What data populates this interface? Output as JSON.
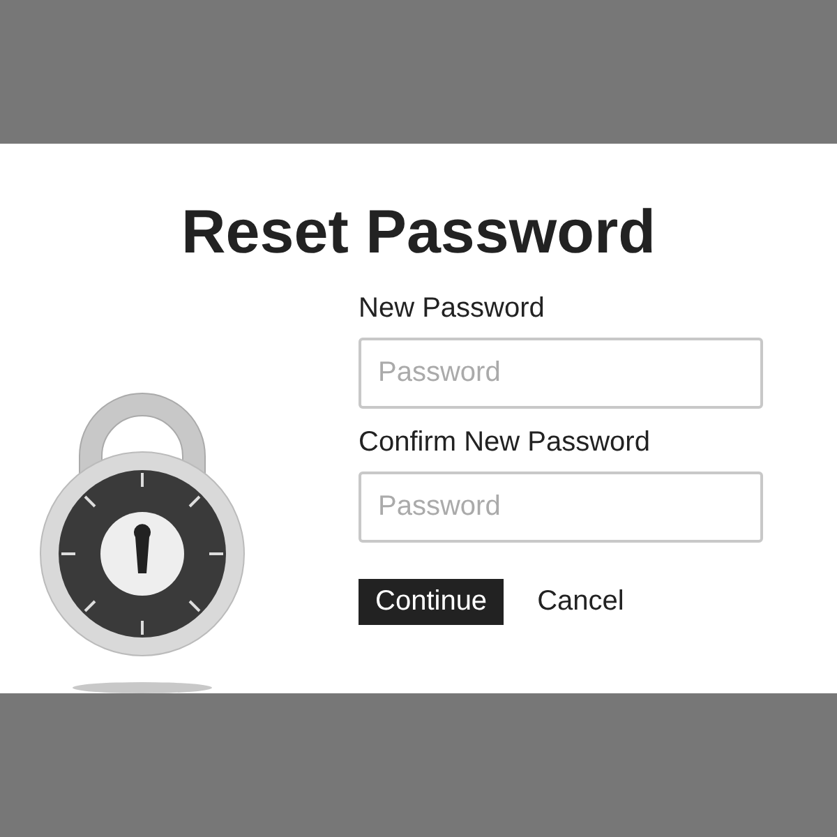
{
  "title": "Reset Password",
  "fields": [
    {
      "label": "New Password",
      "placeholder": "Password"
    },
    {
      "label": "Confirm New Password",
      "placeholder": "Password"
    }
  ],
  "buttons": [
    {
      "label": "Continue",
      "kind": "primary"
    },
    {
      "label": "Cancel",
      "kind": "plain"
    }
  ]
}
